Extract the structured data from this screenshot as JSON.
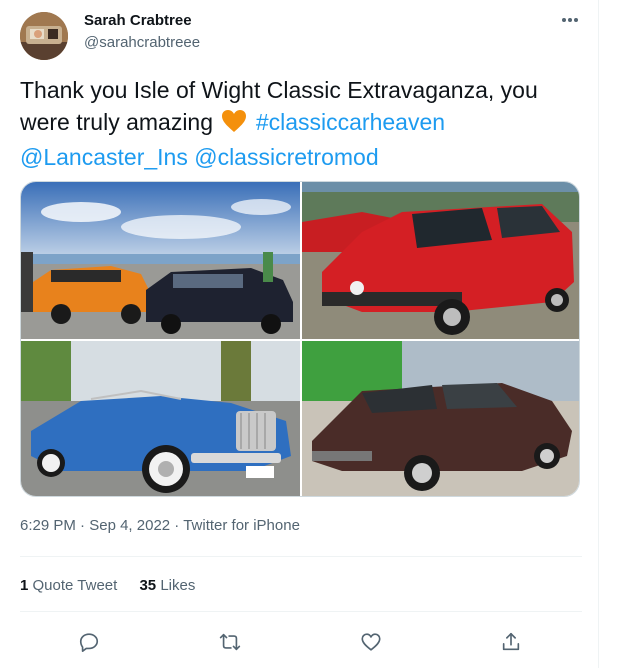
{
  "author": {
    "name": "Sarah Crabtree",
    "handle": "@sarahcrabtreee"
  },
  "tweet": {
    "text_before_emoji": "Thank you Isle of Wight Classic Extravaganza, you were truly amazing",
    "emoji": "orange-heart",
    "hashtag": "#classiccarheaven",
    "mention_1": "@Lancaster_Ins",
    "mention_2": "@classicretromod"
  },
  "media": {
    "photos": [
      {
        "subject": "orange-and-black-estate-cars-seafront"
      },
      {
        "subject": "red-hatchback"
      },
      {
        "subject": "blue-convertible"
      },
      {
        "subject": "brown-coupe"
      }
    ]
  },
  "meta": {
    "time": "6:29 PM",
    "separator": "·",
    "date": "Sep 4, 2022",
    "source": "Twitter for iPhone"
  },
  "stats": {
    "quote_count": "1",
    "quote_label": "Quote Tweet",
    "likes_count": "35",
    "likes_label": "Likes"
  },
  "actions": [
    "reply-icon",
    "retweet-icon",
    "like-icon",
    "share-icon"
  ],
  "colors": {
    "link": "#1d9bf0",
    "secondary_text": "#536471",
    "primary_text": "#0f1419"
  }
}
